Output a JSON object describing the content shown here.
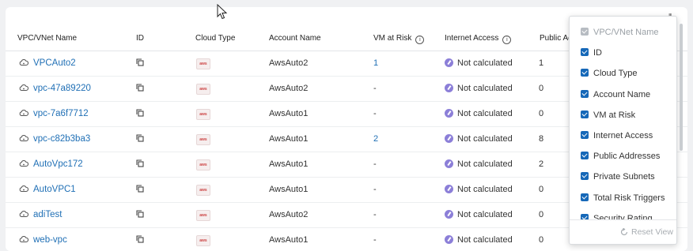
{
  "table": {
    "headers": {
      "name": "VPC/VNet Name",
      "id": "ID",
      "cloud_type": "Cloud Type",
      "account": "Account Name",
      "vm_at_risk": "VM at Risk",
      "internet_access": "Internet Access",
      "public": "Public Ac"
    },
    "rows": [
      {
        "name": "VPCAuto2",
        "account": "AwsAuto2",
        "vm_at_risk": "1",
        "internet_access": "Not calculated",
        "public": "1"
      },
      {
        "name": "vpc-47a89220",
        "account": "AwsAuto2",
        "vm_at_risk": "-",
        "internet_access": "Not calculated",
        "public": "0"
      },
      {
        "name": "vpc-7a6f7712",
        "account": "AwsAuto1",
        "vm_at_risk": "-",
        "internet_access": "Not calculated",
        "public": "0"
      },
      {
        "name": "vpc-c82b3ba3",
        "account": "AwsAuto1",
        "vm_at_risk": "2",
        "internet_access": "Not calculated",
        "public": "8"
      },
      {
        "name": "AutoVpc172",
        "account": "AwsAuto1",
        "vm_at_risk": "-",
        "internet_access": "Not calculated",
        "public": "2"
      },
      {
        "name": "AutoVPC1",
        "account": "AwsAuto1",
        "vm_at_risk": "-",
        "internet_access": "Not calculated",
        "public": "0"
      },
      {
        "name": "adiTest",
        "account": "AwsAuto2",
        "vm_at_risk": "-",
        "internet_access": "Not calculated",
        "public": "0"
      },
      {
        "name": "web-vpc",
        "account": "AwsAuto1",
        "vm_at_risk": "-",
        "internet_access": "Not calculated",
        "public": "0"
      }
    ],
    "cloud_badge": "aws"
  },
  "column_picker": {
    "options": [
      {
        "label": "VPC/VNet Name",
        "checked": true,
        "disabled": true
      },
      {
        "label": "ID",
        "checked": true
      },
      {
        "label": "Cloud Type",
        "checked": true
      },
      {
        "label": "Account Name",
        "checked": true
      },
      {
        "label": "VM at Risk",
        "checked": true
      },
      {
        "label": "Internet Access",
        "checked": true
      },
      {
        "label": "Public Addresses",
        "checked": true
      },
      {
        "label": "Private Subnets",
        "checked": true
      },
      {
        "label": "Total Risk Triggers",
        "checked": true
      },
      {
        "label": "Security Rating",
        "checked": true
      }
    ],
    "reset_label": "Reset View"
  },
  "colors": {
    "link": "#1f6fb5",
    "checkbox": "#1668b8",
    "status_dot": "#8c7fd8"
  }
}
